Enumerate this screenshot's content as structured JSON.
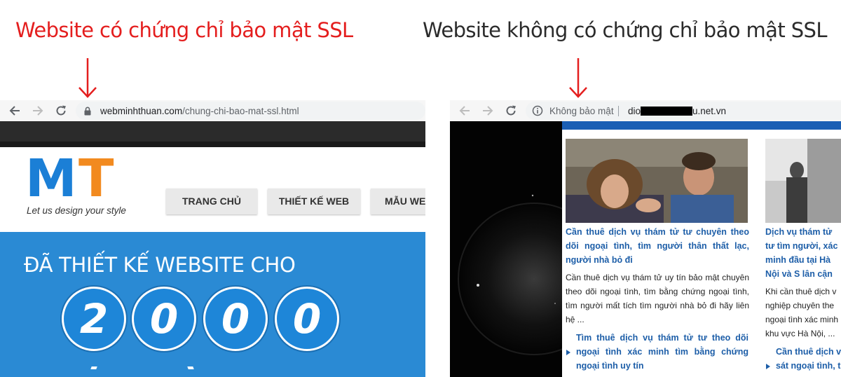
{
  "captions": {
    "left": "Website có chứng chỉ bảo mật SSL",
    "right": "Website không có chứng chỉ bảo mật SSL"
  },
  "left_browser": {
    "url_domain": "webminhthuan.com",
    "url_path": "/chung-chi-bao-mat-ssl.html",
    "secure": true
  },
  "right_browser": {
    "security_label": "Không bảo mật",
    "url_start": "dio",
    "url_end": "u.net.vn",
    "secure": false
  },
  "left_site": {
    "logo_letters": [
      "M",
      "T"
    ],
    "tagline": "Let us design your style",
    "nav": [
      "TRANG CHỦ",
      "THIẾT KẾ WEB",
      "MẪU WEB"
    ],
    "hero_title": "ĐÃ THIẾT KẾ WEBSITE CHO",
    "counter": [
      "2",
      "0",
      "0",
      "0"
    ]
  },
  "right_site": {
    "articles": [
      {
        "title": "Cần thuê dịch vụ thám tử tư chuyên theo dõi ngoại tình, tìm người thân thất lạc, người nhà bỏ đi",
        "excerpt": "Cần thuê dịch vụ thám tử uy tín bảo mật chuyên theo dõi ngoại tình, tìm bằng chứng ngoại tình, tìm người mất tích tìm người nhà bỏ đi hãy liên hệ ...",
        "related": "Tìm thuê dịch vụ thám tử tư theo dõi ngoại tình xác minh tìm bằng chứng ngoại tình uy tín"
      },
      {
        "title": "Dịch vụ thám tử tư tìm người, xác minh đầu tại Hà Nội và S lân cận",
        "excerpt": "Khi cần thuê dịch v nghiệp chuyên the ngoại tình xác minh khu vực Hà Nội, ...",
        "related": "Cần thuê dịch v sát ngoại tình, t"
      }
    ]
  },
  "colors": {
    "caption_left": "#e41e1e",
    "caption_right": "#2b2b2b",
    "logo_m": "#1b7fd6",
    "logo_t": "#f28a1f",
    "hero_bg": "#2a8ad4",
    "link_blue": "#1d5ea8"
  }
}
